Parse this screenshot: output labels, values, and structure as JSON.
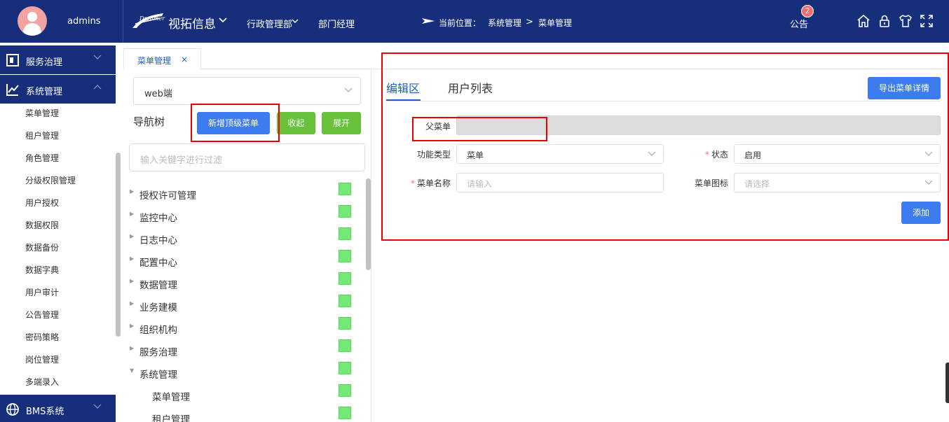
{
  "user": {
    "name": "admins"
  },
  "app": {
    "title": "视拓信息"
  },
  "topnav": {
    "item1": "行政管理部",
    "item2": "部门经理"
  },
  "breadcrumb": {
    "label": "当前位置：",
    "items": [
      "系统管理",
      "菜单管理"
    ],
    "separator": ">"
  },
  "notice": {
    "label": "公告",
    "badge": "2"
  },
  "header_icons": [
    "home-icon",
    "lock-icon",
    "shirt-icon",
    "fullscreen-icon"
  ],
  "sidebar": {
    "groups": [
      {
        "label": "服务治理",
        "icon": "document-icon",
        "expanded": false
      },
      {
        "label": "系统管理",
        "icon": "line-chart-icon",
        "expanded": true
      },
      {
        "label": "BMS系统",
        "icon": "globe-icon",
        "expanded": false
      }
    ],
    "items": [
      "菜单管理",
      "租户管理",
      "角色管理",
      "分级权限管理",
      "用户授权",
      "数据权限",
      "数据备份",
      "数据字典",
      "用户审计",
      "公告管理",
      "密码策略",
      "岗位管理",
      "多端录入"
    ]
  },
  "tabs": [
    {
      "label": "菜单管理",
      "close": "×",
      "active": true
    }
  ],
  "tree_panel": {
    "platform_select": "web端",
    "title": "导航树",
    "buttons": {
      "add_top": "新增顶级菜单",
      "collapse": "收起",
      "expand": "展开"
    },
    "filter_placeholder": "输入关键字进行过滤",
    "nodes": [
      {
        "label": "授权许可管理",
        "level": 0,
        "expanded": false,
        "checked": true
      },
      {
        "label": "监控中心",
        "level": 0,
        "expanded": false,
        "checked": true
      },
      {
        "label": "日志中心",
        "level": 0,
        "expanded": false,
        "checked": true
      },
      {
        "label": "配置中心",
        "level": 0,
        "expanded": false,
        "checked": true
      },
      {
        "label": "数据管理",
        "level": 0,
        "expanded": false,
        "checked": true
      },
      {
        "label": "业务建模",
        "level": 0,
        "expanded": false,
        "checked": true
      },
      {
        "label": "组织机构",
        "level": 0,
        "expanded": false,
        "checked": true
      },
      {
        "label": "服务治理",
        "level": 0,
        "expanded": false,
        "checked": true
      },
      {
        "label": "系统管理",
        "level": 0,
        "expanded": true,
        "checked": true
      },
      {
        "label": "菜单管理",
        "level": 1,
        "expanded": false,
        "checked": true
      },
      {
        "label": "租户管理",
        "level": 1,
        "expanded": false,
        "checked": true
      }
    ]
  },
  "edit_panel": {
    "tabs": {
      "edit": "编辑区",
      "users": "用户列表"
    },
    "export_button": "导出菜单详情",
    "form": {
      "parent": {
        "label": "父菜单",
        "value": ""
      },
      "type": {
        "label": "功能类型",
        "value": "菜单"
      },
      "status": {
        "label": "状态",
        "value": "启用",
        "required": true
      },
      "name": {
        "label": "菜单名称",
        "placeholder": "请输入",
        "required": true
      },
      "icon": {
        "label": "菜单图标",
        "placeholder": "请选择"
      }
    },
    "add_button": "添加"
  },
  "colors": {
    "header_bg": "#172f7b",
    "primary": "#3d7cf0",
    "success": "#67c23a",
    "checkbox": "#74ea74",
    "highlight": "#e00000"
  }
}
